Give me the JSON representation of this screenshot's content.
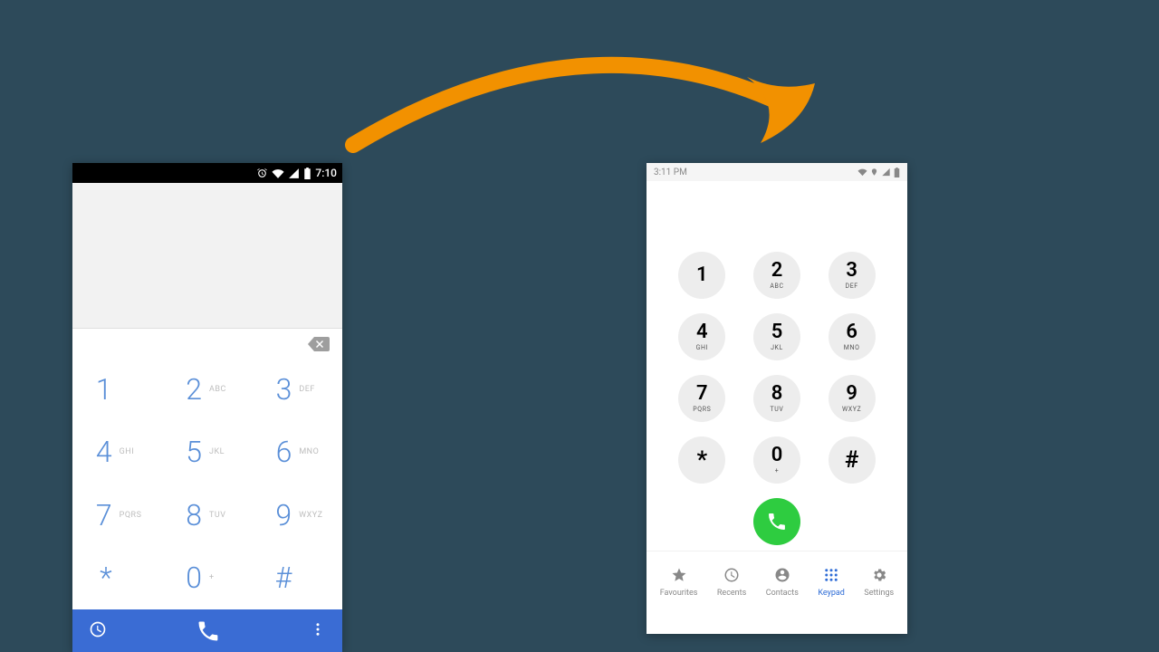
{
  "left": {
    "status_time": "7:10",
    "keys": [
      {
        "d": "1",
        "l": ""
      },
      {
        "d": "2",
        "l": "ABC"
      },
      {
        "d": "3",
        "l": "DEF"
      },
      {
        "d": "4",
        "l": "GHI"
      },
      {
        "d": "5",
        "l": "JKL"
      },
      {
        "d": "6",
        "l": "MNO"
      },
      {
        "d": "7",
        "l": "PQRS"
      },
      {
        "d": "8",
        "l": "TUV"
      },
      {
        "d": "9",
        "l": "WXYZ"
      },
      {
        "d": "*",
        "l": ""
      },
      {
        "d": "0",
        "l": "+"
      },
      {
        "d": "#",
        "l": ""
      }
    ]
  },
  "right": {
    "status_time": "3:11 PM",
    "keys": [
      {
        "d": "1",
        "l": ""
      },
      {
        "d": "2",
        "l": "ABC"
      },
      {
        "d": "3",
        "l": "DEF"
      },
      {
        "d": "4",
        "l": "GHI"
      },
      {
        "d": "5",
        "l": "JKL"
      },
      {
        "d": "6",
        "l": "MNO"
      },
      {
        "d": "7",
        "l": "PQRS"
      },
      {
        "d": "8",
        "l": "TUV"
      },
      {
        "d": "9",
        "l": "WXYZ"
      },
      {
        "d": "*",
        "l": ""
      },
      {
        "d": "0",
        "l": "+"
      },
      {
        "d": "#",
        "l": ""
      }
    ],
    "tabs": [
      {
        "id": "favourites",
        "label": "Favourites"
      },
      {
        "id": "recents",
        "label": "Recents"
      },
      {
        "id": "contacts",
        "label": "Contacts"
      },
      {
        "id": "keypad",
        "label": "Keypad"
      },
      {
        "id": "settings",
        "label": "Settings"
      }
    ],
    "active_tab": "keypad"
  }
}
